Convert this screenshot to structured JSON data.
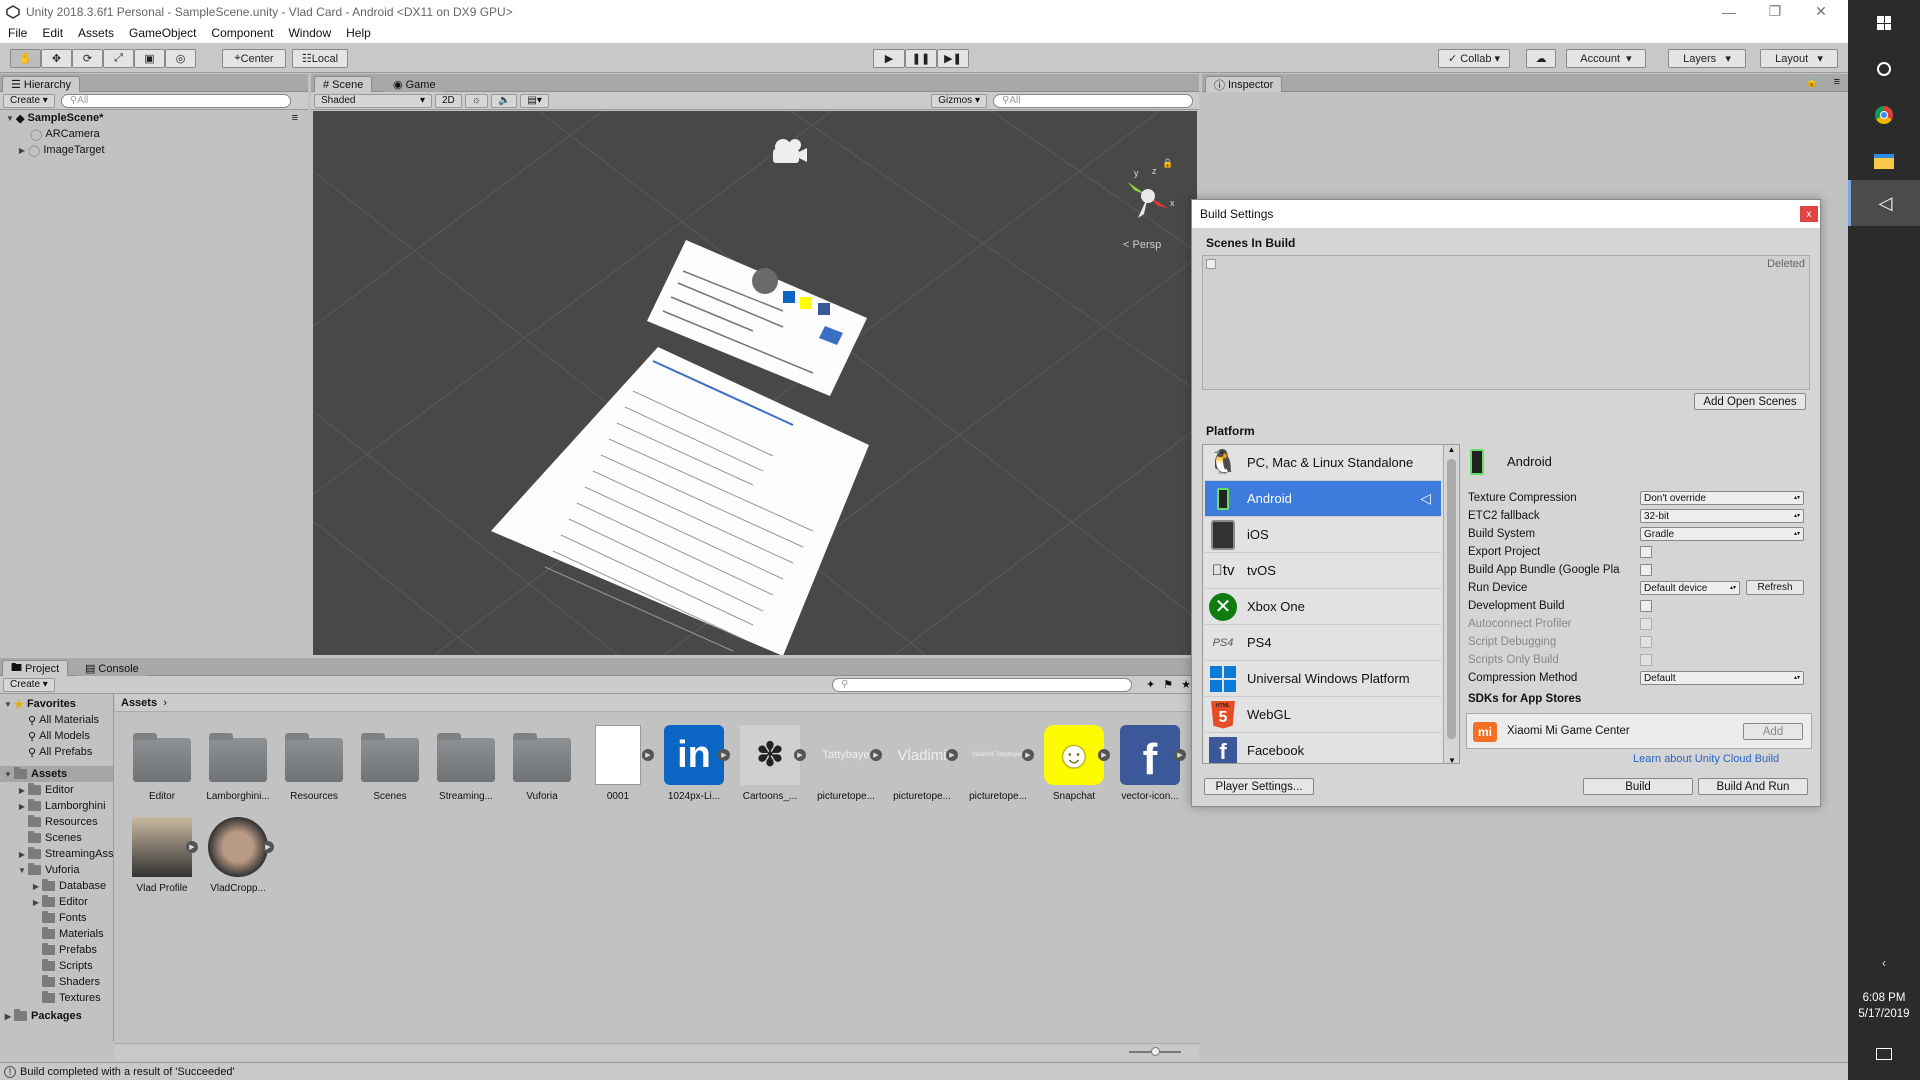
{
  "window": {
    "title": "Unity 2018.3.6f1 Personal - SampleScene.unity - Vlad Card - Android <DX11 on DX9 GPU>"
  },
  "menu": [
    "File",
    "Edit",
    "Assets",
    "GameObject",
    "Component",
    "Window",
    "Help"
  ],
  "toolbar": {
    "center": "Center",
    "local": "Local",
    "collab": "Collab",
    "account": "Account",
    "layers": "Layers",
    "layout": "Layout"
  },
  "hierarchy": {
    "tab": "Hierarchy",
    "create": "Create",
    "search_placeholder": "All",
    "scene": "SampleScene*",
    "items": [
      "ARCamera",
      "ImageTarget"
    ]
  },
  "scene": {
    "tab_scene": "Scene",
    "tab_game": "Game",
    "shaded": "Shaded",
    "mode_2d": "2D",
    "gizmos": "Gizmos",
    "search_placeholder": "All",
    "persp": "Persp",
    "axis_x": "x",
    "axis_y": "y",
    "axis_z": "z"
  },
  "inspector": {
    "tab": "Inspector"
  },
  "project": {
    "tab_project": "Project",
    "tab_console": "Console",
    "create": "Create",
    "breadcrumb": "Assets",
    "favorites_label": "Favorites",
    "favorites": [
      "All Materials",
      "All Models",
      "All Prefabs"
    ],
    "assets_label": "Assets",
    "tree": [
      "Editor",
      "Lamborghini",
      "Resources",
      "Scenes",
      "StreamingAssets",
      "Vuforia",
      "Database",
      "Editor",
      "Fonts",
      "Materials",
      "Prefabs",
      "Scripts",
      "Shaders",
      "Textures"
    ],
    "packages_label": "Packages",
    "grid": [
      "Editor",
      "Lamborghini...",
      "Resources",
      "Scenes",
      "Streaming...",
      "Vuforia",
      "0001",
      "1024px-Li...",
      "Cartoons_...",
      "picturetope...",
      "picturetope...",
      "picturetope...",
      "Snapchat",
      "vector-icon...",
      "Vlad Profile",
      "VladCropp..."
    ],
    "thumb_text": [
      "Tattybaye",
      "Vladimi",
      "Vladimir Tattybayev"
    ]
  },
  "status": {
    "message": "Build completed with a result of 'Succeeded'"
  },
  "build_settings": {
    "title": "Build Settings",
    "close": "x",
    "scenes_in_build": "Scenes In Build",
    "deleted": "Deleted",
    "add_open_scenes": "Add Open Scenes",
    "platform_label": "Platform",
    "platforms": [
      "PC, Mac & Linux Standalone",
      "Android",
      "iOS",
      "tvOS",
      "Xbox One",
      "PS4",
      "Universal Windows Platform",
      "WebGL",
      "Facebook"
    ],
    "selected_platform": "Android",
    "tv_glyph": "tv",
    "ps4_glyph": "PS4",
    "html_glyph": "HTML",
    "settings": {
      "texture_compression": {
        "label": "Texture Compression",
        "value": "Don't override"
      },
      "etc2_fallback": {
        "label": "ETC2 fallback",
        "value": "32-bit"
      },
      "build_system": {
        "label": "Build System",
        "value": "Gradle"
      },
      "export_project": {
        "label": "Export Project"
      },
      "build_app_bundle": {
        "label": "Build App Bundle (Google Pla"
      },
      "run_device": {
        "label": "Run Device",
        "value": "Default device",
        "refresh": "Refresh"
      },
      "development_build": {
        "label": "Development Build"
      },
      "autoconnect_profiler": {
        "label": "Autoconnect Profiler"
      },
      "script_debugging": {
        "label": "Script Debugging"
      },
      "scripts_only_build": {
        "label": "Scripts Only Build"
      },
      "compression_method": {
        "label": "Compression Method",
        "value": "Default"
      }
    },
    "sdks_label": "SDKs for App Stores",
    "sdk_item": "Xiaomi Mi Game Center",
    "sdk_logo": "mi",
    "sdk_add": "Add",
    "cloud_link": "Learn about Unity Cloud Build",
    "player_settings": "Player Settings...",
    "build": "Build",
    "build_and_run": "Build And Run"
  },
  "taskbar": {
    "time": "6:08 PM",
    "date": "5/17/2019"
  },
  "colors": {
    "accent": "#3d7bdc",
    "scene_bg": "#484848",
    "panel": "#c2c2c2",
    "taskbar": "#2b2b2b"
  }
}
